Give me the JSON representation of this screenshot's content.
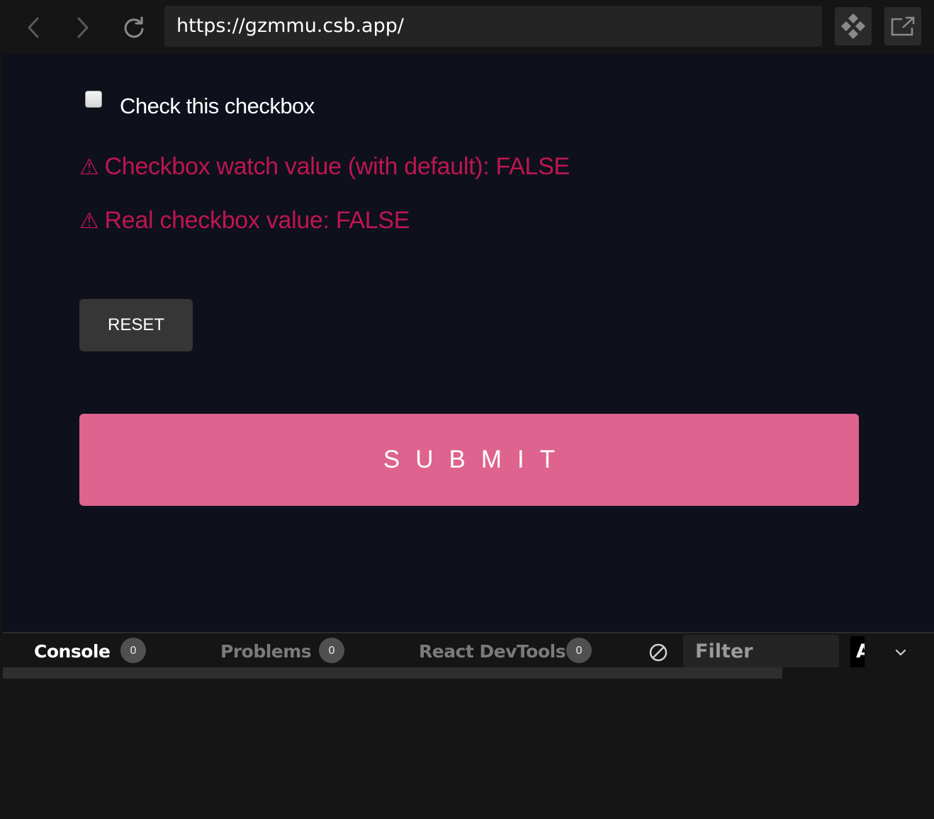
{
  "browser": {
    "url": "https://gzmmu.csb.app/",
    "icons": {
      "back": "chevron-left-icon",
      "forward": "chevron-right-icon",
      "reload": "reload-icon",
      "codesandbox": "codesandbox-logo-icon",
      "open_external": "open-in-new-window-icon"
    }
  },
  "form": {
    "checkbox_label": "Check this checkbox",
    "checkbox_checked": false,
    "warning_icon": "⚠",
    "watch_value_text": "Checkbox watch value (with default): FALSE",
    "real_value_text": "Real checkbox value: FALSE",
    "reset_label": "RESET",
    "submit_label": "SUBMIT",
    "colors": {
      "background": "#0e101c",
      "error": "#bf1650",
      "submit": "#de638e",
      "reset": "#363636"
    }
  },
  "devtools": {
    "tabs": [
      {
        "label": "Console",
        "count": "0",
        "active": true
      },
      {
        "label": "Problems",
        "count": "0",
        "active": false
      },
      {
        "label": "React DevTools",
        "count": "0",
        "active": false
      }
    ],
    "filter_placeholder": "Filter",
    "level_label": "A",
    "icons": {
      "clear": "clear-console-icon",
      "collapse": "chevron-down-icon"
    }
  }
}
